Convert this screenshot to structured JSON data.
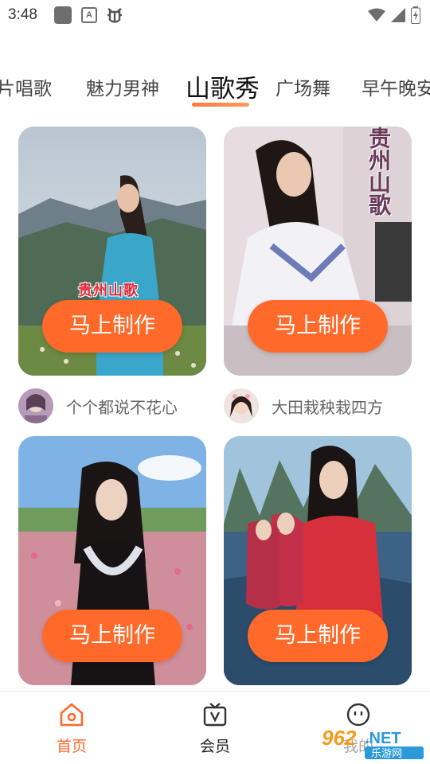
{
  "status_bar": {
    "time": "3:48",
    "left_icons": [
      "app-square-icon",
      "a-badge-icon",
      "bug-icon"
    ],
    "a_badge": "A",
    "right_icons": [
      "wifi-icon",
      "signal-icon",
      "battery-icon"
    ]
  },
  "tabs": [
    {
      "label": "片唱歌"
    },
    {
      "label": "魅力男神"
    },
    {
      "label": "山歌秀",
      "active": true
    },
    {
      "label": "广场舞"
    },
    {
      "label": "早午晚安"
    }
  ],
  "accent_color": "#ff6a2a",
  "cards": [
    {
      "make_label": "马上制作",
      "overlay": "贵州山歌",
      "author": "个个都说不花心"
    },
    {
      "make_label": "马上制作",
      "overlay": "贵州山歌",
      "author": "大田栽秧栽四方"
    },
    {
      "make_label": "马上制作"
    },
    {
      "make_label": "马上制作"
    }
  ],
  "bottom_nav": [
    {
      "label": "首页",
      "icon": "home-icon",
      "active": true
    },
    {
      "label": "会员",
      "icon": "vip-tv-icon"
    },
    {
      "label": "我的",
      "icon": "profile-face-icon"
    }
  ],
  "watermark": {
    "brand": "962",
    "suffix": ".NET",
    "sub": "乐游网"
  }
}
